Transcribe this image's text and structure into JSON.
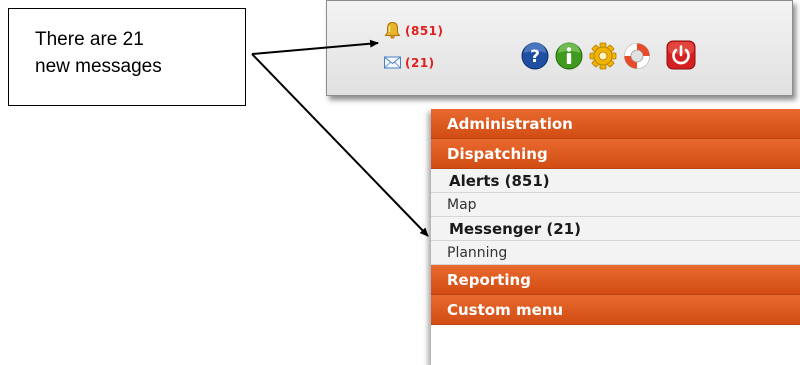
{
  "callout": {
    "line1": "There are 21",
    "line2": "new messages"
  },
  "toolbar": {
    "alerts": {
      "icon": "bell-icon",
      "count": "(851)"
    },
    "messages": {
      "icon": "envelope-icon",
      "count": "(21)"
    },
    "buttons": [
      {
        "icon": "help-icon",
        "color": "#1f4fa0"
      },
      {
        "icon": "info-icon",
        "color": "#3f9a1f"
      },
      {
        "icon": "settings-gear-icon",
        "color": "#f0b400"
      },
      {
        "icon": "lifebuoy-icon",
        "color": "#e84a2a"
      },
      {
        "icon": "power-icon",
        "color": "#d42020"
      }
    ]
  },
  "menu": {
    "administration": "Administration",
    "dispatching": "Dispatching",
    "alerts": "Alerts (851)",
    "map": "Map",
    "messenger": "Messenger (21)",
    "planning": "Planning",
    "reporting": "Reporting",
    "custom_menu": "Custom menu"
  },
  "colors": {
    "menu_header": "#dd5a1f",
    "count_text": "#e01f1f"
  }
}
